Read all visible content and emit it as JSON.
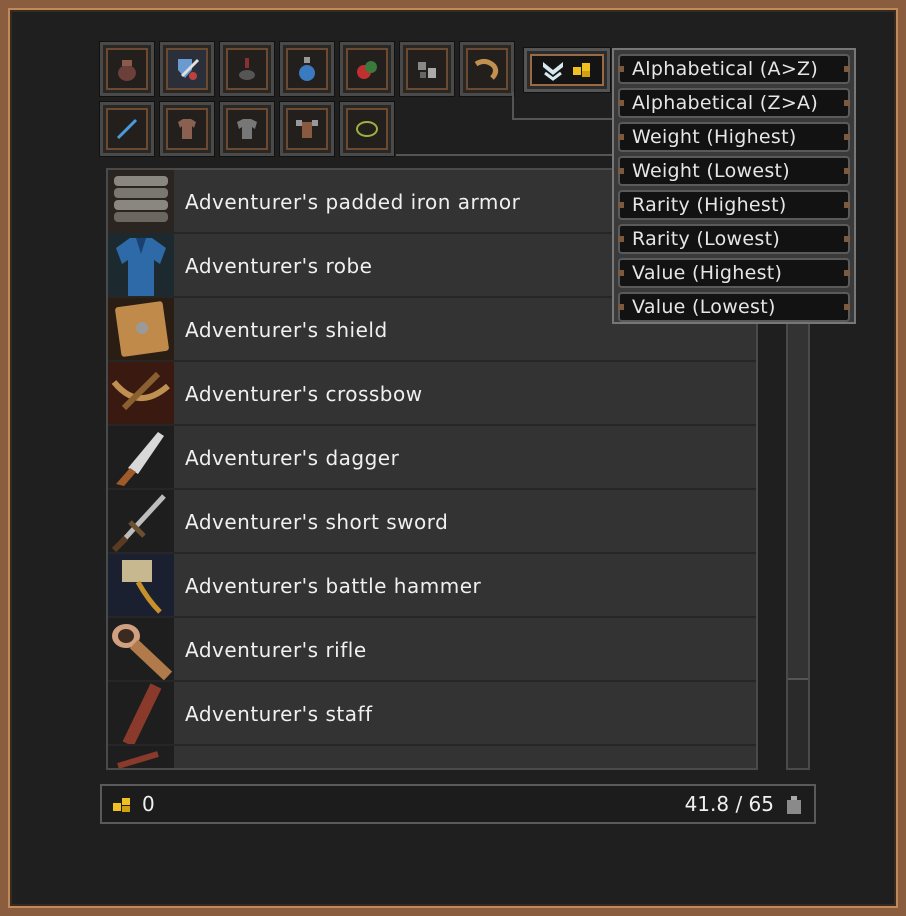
{
  "categories": [
    {
      "name": "bag-icon"
    },
    {
      "name": "shield-sword-icon"
    },
    {
      "name": "potion-red-icon"
    },
    {
      "name": "potion-blue-icon"
    },
    {
      "name": "food-icon"
    },
    {
      "name": "tools-icon"
    },
    {
      "name": "horn-icon"
    },
    {
      "name": "sword-icon"
    },
    {
      "name": "leather-armor-icon"
    },
    {
      "name": "plate-armor-icon"
    },
    {
      "name": "chest-armor-icon"
    },
    {
      "name": "necklace-icon"
    }
  ],
  "sort_button": {
    "icon": "sort-gold-icon"
  },
  "sort_options": [
    "Alphabetical (A>Z)",
    "Alphabetical (Z>A)",
    "Weight (Highest)",
    "Weight (Lowest)",
    "Rarity (Highest)",
    "Rarity (Lowest)",
    "Value (Highest)",
    "Value (Lowest)"
  ],
  "items": [
    {
      "label": "Adventurer's padded iron armor",
      "icon": "padded-armor-icon"
    },
    {
      "label": "Adventurer's robe",
      "icon": "robe-icon"
    },
    {
      "label": "Adventurer's shield",
      "icon": "shield-icon"
    },
    {
      "label": "Adventurer's crossbow",
      "icon": "crossbow-icon"
    },
    {
      "label": "Adventurer's dagger",
      "icon": "dagger-icon"
    },
    {
      "label": "Adventurer's short sword",
      "icon": "short-sword-icon"
    },
    {
      "label": "Adventurer's battle hammer",
      "icon": "hammer-icon"
    },
    {
      "label": "Adventurer's rifle",
      "icon": "rifle-icon"
    },
    {
      "label": "Adventurer's staff",
      "icon": "staff-icon"
    }
  ],
  "footer": {
    "gold": "0",
    "weight": "41.8 / 65"
  },
  "colors": {
    "frame": "#8a5d3f",
    "panel": "#333333",
    "gold": "#f0c020"
  }
}
